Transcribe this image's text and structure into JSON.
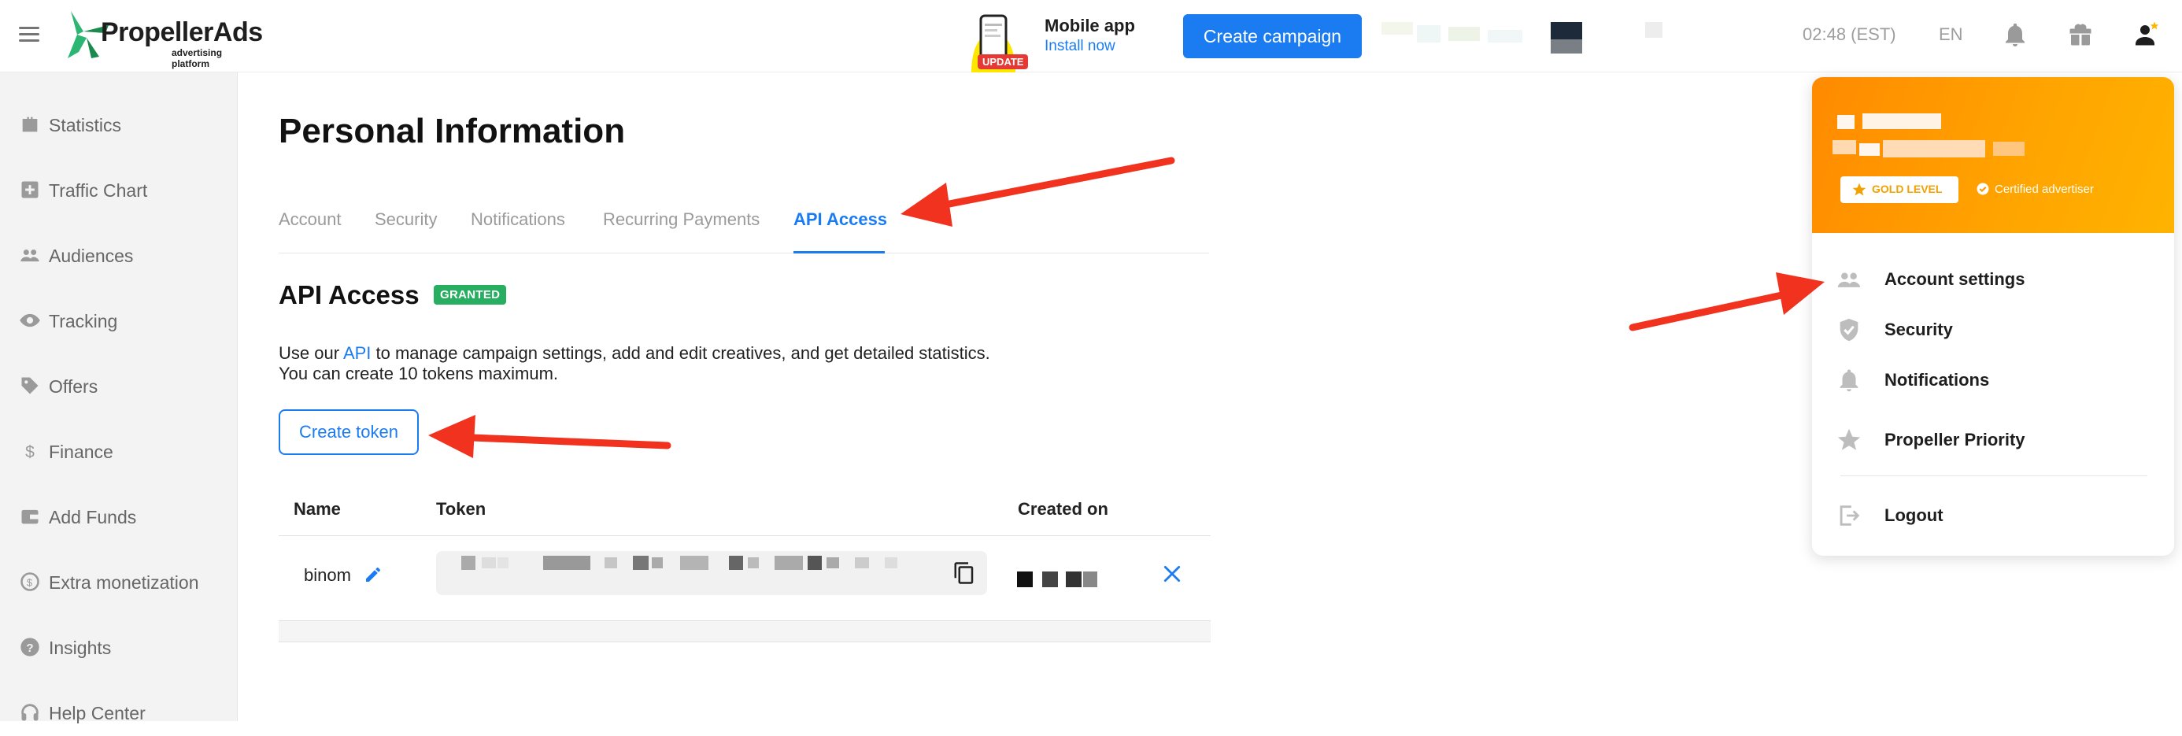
{
  "header": {
    "logo_name": "PropellerAds",
    "logo_tagline": "advertising platform",
    "mobile_app_title": "Mobile app",
    "mobile_app_link": "Install now",
    "update_badge": "UPDATE",
    "create_campaign_label": "Create campaign",
    "time": "02:48 (EST)",
    "language": "EN",
    "brand_color": "#1b7cf2"
  },
  "sidebar": {
    "items": [
      {
        "label": "Statistics",
        "icon": "briefcase-icon"
      },
      {
        "label": "Traffic Chart",
        "icon": "chart-plus-icon"
      },
      {
        "label": "Audiences",
        "icon": "people-icon"
      },
      {
        "label": "Tracking",
        "icon": "eye-icon"
      },
      {
        "label": "Offers",
        "icon": "tag-icon"
      },
      {
        "label": "Finance",
        "icon": "dollar-icon"
      },
      {
        "label": "Add Funds",
        "icon": "wallet-icon"
      },
      {
        "label": "Extra monetization",
        "icon": "refresh-coin-icon"
      },
      {
        "label": "Insights",
        "icon": "question-circle-icon"
      },
      {
        "label": "Help Center",
        "icon": "headset-icon"
      }
    ]
  },
  "main": {
    "page_title": "Personal Information",
    "tabs": [
      {
        "label": "Account",
        "active": false
      },
      {
        "label": "Security",
        "active": false
      },
      {
        "label": "Notifications",
        "active": false
      },
      {
        "label": "Recurring Payments",
        "active": false
      },
      {
        "label": "API Access",
        "active": true
      }
    ],
    "section_title": "API Access",
    "status_badge": "GRANTED",
    "description_pre": "Use our ",
    "description_link": "API",
    "description_post": " to manage campaign settings, add and edit creatives, and get detailed statistics.",
    "description_line2": "You can create 10 tokens maximum.",
    "create_token_label": "Create token",
    "table": {
      "columns": [
        "Name",
        "Token",
        "Created on"
      ],
      "rows": [
        {
          "name": "binom"
        }
      ]
    }
  },
  "dropdown": {
    "level_badge": "GOLD LEVEL",
    "certified_label": "Certified advertiser",
    "items": [
      {
        "label": "Account settings",
        "icon": "people-icon"
      },
      {
        "label": "Security",
        "icon": "shield-check-icon"
      },
      {
        "label": "Notifications",
        "icon": "bell-icon"
      },
      {
        "label": "Propeller Priority",
        "icon": "star-icon"
      },
      {
        "label": "Logout",
        "icon": "logout-icon"
      }
    ],
    "banner_color": "#ff9800"
  },
  "annotation_color": "#f0321e"
}
